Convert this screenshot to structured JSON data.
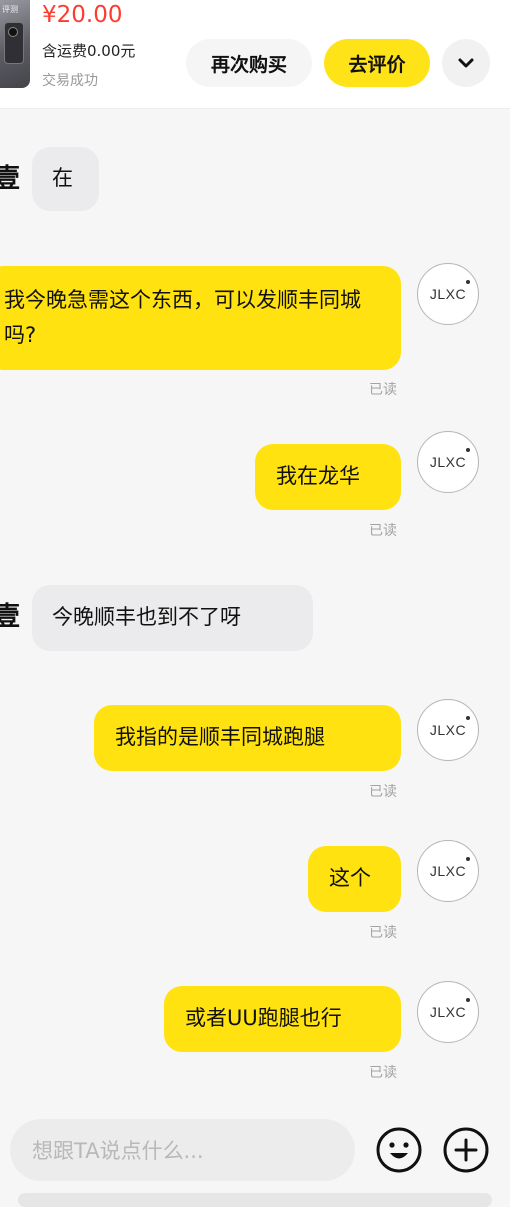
{
  "header": {
    "thumb_label": "评测",
    "price": "¥20.00",
    "shipping": "含运费0.00元",
    "status": "交易成功",
    "buy_again_label": "再次购买",
    "review_label": "去评价",
    "more_icon": "chevron-down-icon"
  },
  "chat": {
    "peer_name_fragment": "壹",
    "my_avatar_text": "JLXC",
    "read_label": "已读",
    "messages": [
      {
        "side": "in",
        "text": "在"
      },
      {
        "side": "out",
        "text": "我今晚急需这个东西，可以发顺丰同城吗?"
      },
      {
        "side": "out",
        "text": "我在龙华"
      },
      {
        "side": "in",
        "text": "今晚顺丰也到不了呀"
      },
      {
        "side": "out",
        "text": "我指的是顺丰同城跑腿"
      },
      {
        "side": "out",
        "text": "这个"
      },
      {
        "side": "out",
        "text": "或者UU跑腿也行"
      }
    ]
  },
  "input": {
    "placeholder": "想跟TA说点什么...",
    "emoji_icon": "emoji-icon",
    "plus_icon": "plus-icon"
  },
  "colors": {
    "accent_yellow": "#ffe20f",
    "price_red": "#ff3b30",
    "incoming_bubble": "#ebebed",
    "background": "#f6f6f6"
  }
}
